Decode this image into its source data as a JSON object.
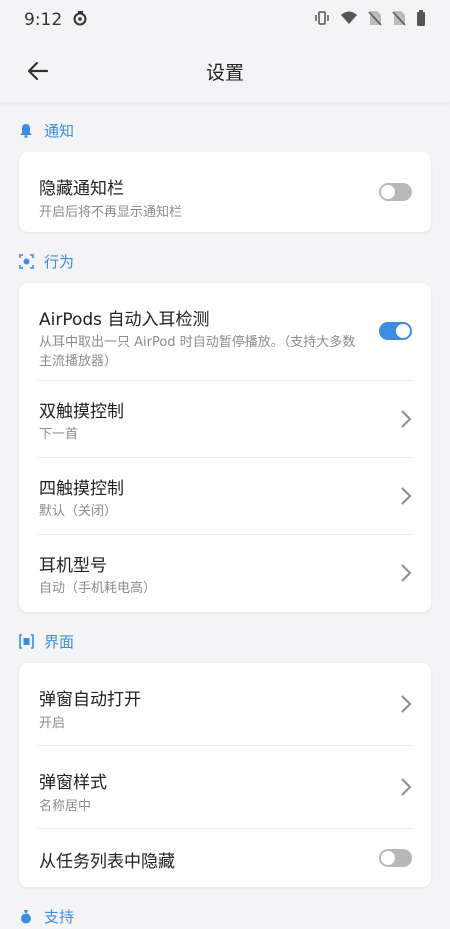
{
  "status_bar": {
    "time": "9:12"
  },
  "app_bar": {
    "title": "设置"
  },
  "sections": {
    "notify": {
      "title": "通知"
    },
    "behavior": {
      "title": "行为"
    },
    "interface": {
      "title": "界面"
    },
    "support": {
      "title": "支持"
    }
  },
  "notify": {
    "hide_bar": {
      "label": "隐藏通知栏",
      "desc": "开启后将不再显示通知栏",
      "enabled": false
    }
  },
  "behavior": {
    "ear_detect": {
      "label": "AirPods 自动入耳检测",
      "desc": "从耳中取出一只 AirPod 时自动暂停播放。（支持大多数主流播放器）",
      "enabled": true
    },
    "double_touch": {
      "label": "双触摸控制",
      "value": "下一首"
    },
    "quad_touch": {
      "label": "四触摸控制",
      "value": "默认（关闭）"
    },
    "model": {
      "label": "耳机型号",
      "value": "自动（手机耗电高）"
    }
  },
  "interface": {
    "popup_auto": {
      "label": "弹窗自动打开",
      "value": "开启"
    },
    "popup_style": {
      "label": "弹窗样式",
      "value": "名称居中"
    },
    "hide_recents": {
      "label": "从任务列表中隐藏",
      "enabled": false
    }
  },
  "colors": {
    "accent": "#3a8de0",
    "toggle_off": "#b8b8b8",
    "background": "#f4f4f6"
  },
  "icons": {
    "status_left": "app-notification-icon",
    "status_right": [
      "vibrate-icon",
      "wifi-icon",
      "no-sim-icon",
      "no-sim-icon",
      "battery-icon"
    ],
    "back": "arrow-left-icon",
    "sections": [
      "bell-icon",
      "behavior-icon",
      "interface-icon",
      "support-icon"
    ],
    "row_chevron": "chevron-right-icon"
  }
}
